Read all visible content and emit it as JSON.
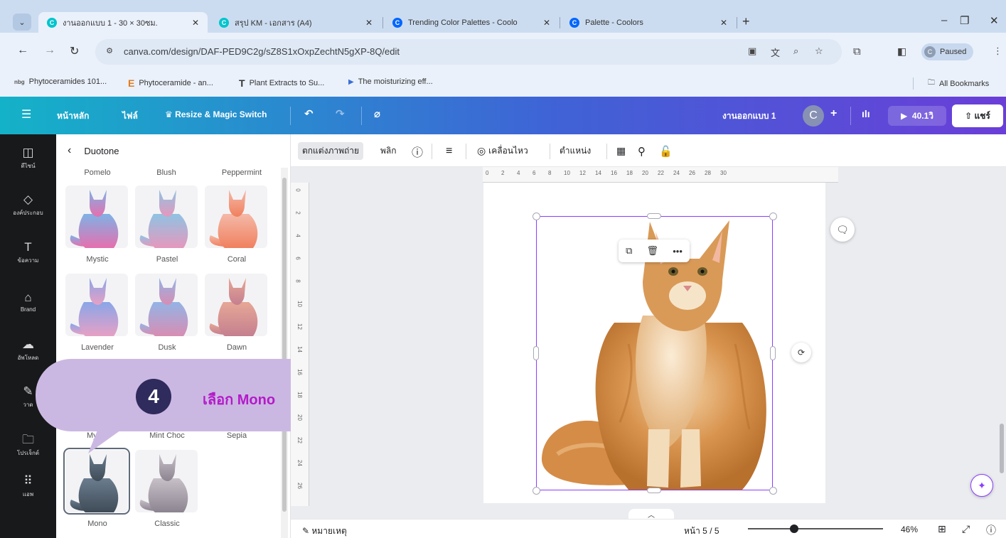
{
  "browser": {
    "tabs": [
      {
        "title": "งานออกแบบ 1 - 30 × 30ซม.",
        "favicon": "canva-icon",
        "favicon_color": "#00c4cc"
      },
      {
        "title": "สรุป KM - เอกสาร (A4)",
        "favicon": "canva-icon",
        "favicon_color": "#00c4cc"
      },
      {
        "title": "Trending Color Palettes - Coolo",
        "favicon": "coolors-icon",
        "favicon_color": "#0066ff"
      },
      {
        "title": "Palette - Coolors",
        "favicon": "coolors-icon",
        "favicon_color": "#0066ff"
      }
    ],
    "url": "canva.com/design/DAF-PED9C2g/sZ8S1xOxpZechtN5gXP-8Q/edit",
    "profile_status": "Paused",
    "profile_initial": "C",
    "bookmarks": [
      {
        "label": "Phytoceramides 101...",
        "icon": "nbg"
      },
      {
        "label": "Phytoceramide - an...",
        "icon": "E"
      },
      {
        "label": "Plant Extracts to Su...",
        "icon": "T"
      },
      {
        "label": "The moisturizing eff...",
        "icon": "play-icon"
      }
    ],
    "all_bookmarks": "All Bookmarks"
  },
  "canva": {
    "nav": {
      "home": "หน้าหลัก",
      "file": "ไฟล์",
      "resize": "Resize & Magic Switch"
    },
    "design_title": "งานออกแบบ 1",
    "avatar_initial": "C",
    "present_label": "40.1วิ",
    "share_label": "แชร์",
    "brand_gradient": [
      "#14b2c8",
      "#3f63d6",
      "#6a3ed8"
    ]
  },
  "rail": [
    {
      "label": "ดีไซน์",
      "icon": "layout-icon"
    },
    {
      "label": "องค์ประกอบ",
      "icon": "elements-icon"
    },
    {
      "label": "ข้อความ",
      "icon": "text-icon"
    },
    {
      "label": "Brand",
      "icon": "brand-icon"
    },
    {
      "label": "อัพโหลด",
      "icon": "upload-icon"
    },
    {
      "label": "วาด",
      "icon": "draw-icon"
    },
    {
      "label": "โปรเจ็กต์",
      "icon": "folder-icon"
    },
    {
      "label": "แอพ",
      "icon": "apps-icon"
    }
  ],
  "panel": {
    "title": "Duotone",
    "row0_labels": [
      "Pomelo",
      "Blush",
      "Peppermint"
    ],
    "effects": [
      {
        "name": "Mystic",
        "c1": "#7fb2e6",
        "c2": "#e66fae"
      },
      {
        "name": "Pastel",
        "c1": "#8fc3e3",
        "c2": "#e598bd"
      },
      {
        "name": "Coral",
        "c1": "#f4b9a8",
        "c2": "#f0805e"
      },
      {
        "name": "Lavender",
        "c1": "#8aa6e8",
        "c2": "#e7a0c4"
      },
      {
        "name": "Dusk",
        "c1": "#93b4e6",
        "c2": "#d88db3"
      },
      {
        "name": "Dawn",
        "c1": "#e6a796",
        "c2": "#c57f8f"
      },
      {
        "name": "Myrtle"
      },
      {
        "name": "Mint Choc"
      },
      {
        "name": "Sepia"
      },
      {
        "name": "Mono",
        "c1": "#6b7d8f",
        "c2": "#3f4b57",
        "selected": true
      },
      {
        "name": "Classic",
        "c1": "#c8c0c8",
        "c2": "#8c8490"
      }
    ]
  },
  "callout": {
    "number": "4",
    "text": "เลือก Mono",
    "text_color": "#b41ac9",
    "bubble_color": "#cbb8e2"
  },
  "toolbar": {
    "edit_photo": "ตกแต่งภาพถ่าย",
    "flip": "พลิก",
    "animate": "เคลื่อนไหว",
    "position": "ตำแหน่ง"
  },
  "ruler": {
    "h": [
      "0",
      "2",
      "4",
      "6",
      "8",
      "10",
      "12",
      "14",
      "16",
      "18",
      "20",
      "22",
      "24",
      "26",
      "28",
      "30"
    ],
    "v": [
      "0",
      "2",
      "4",
      "6",
      "8",
      "10",
      "12",
      "14",
      "16",
      "18",
      "20",
      "22",
      "24",
      "26"
    ]
  },
  "footer": {
    "notes": "หมายเหตุ",
    "page": "หน้า 5 / 5",
    "zoom": "46%",
    "zoom_level": 0.34
  }
}
